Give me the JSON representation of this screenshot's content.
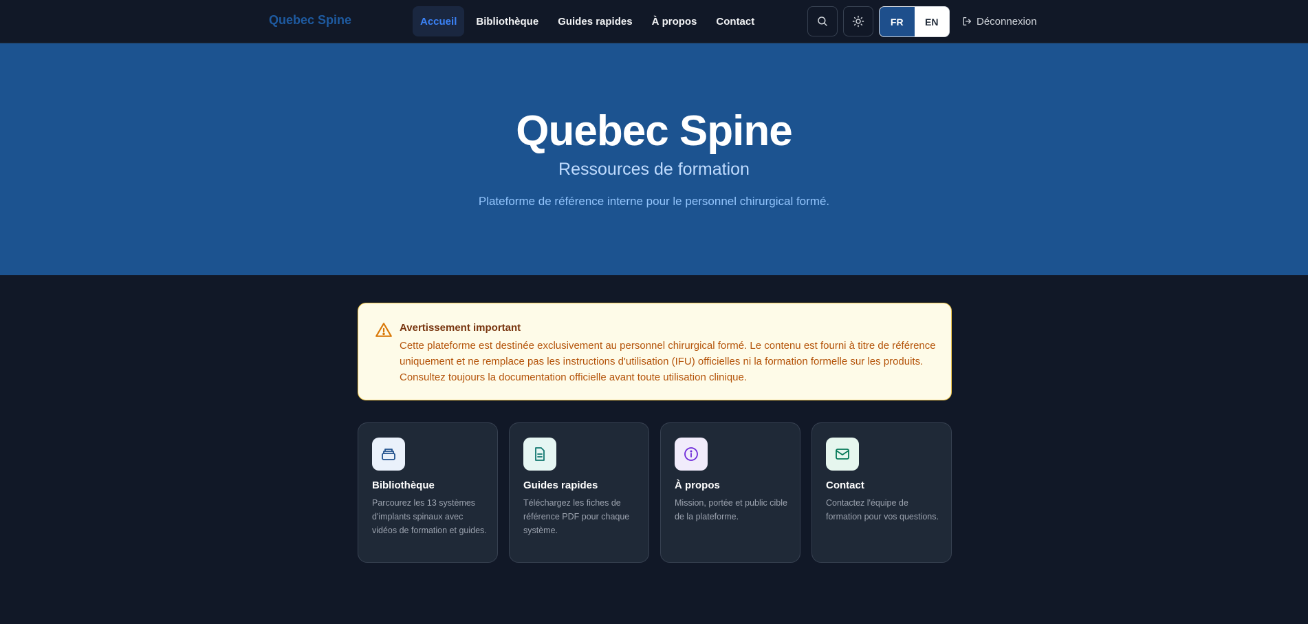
{
  "nav": {
    "brand": "Quebec Spine",
    "links": [
      {
        "label": "Accueil",
        "active": true
      },
      {
        "label": "Bibliothèque",
        "active": false
      },
      {
        "label": "Guides rapides",
        "active": false
      },
      {
        "label": "À propos",
        "active": false
      },
      {
        "label": "Contact",
        "active": false
      }
    ],
    "search_icon": "search-icon",
    "theme_icon": "sun-icon",
    "languages": [
      {
        "label": "FR",
        "active": true
      },
      {
        "label": "EN",
        "active": false
      }
    ],
    "logout_label": "Déconnexion",
    "logout_icon": "logout-icon"
  },
  "hero": {
    "title": "Quebec Spine",
    "subtitle": "Ressources de formation",
    "description": "Plateforme de référence interne pour le personnel chirurgical formé."
  },
  "warning": {
    "icon": "warning-triangle-icon",
    "title": "Avertissement important",
    "text": "Cette plateforme est destinée exclusivement au personnel chirurgical formé. Le contenu est fourni à titre de référence uniquement et ne remplace pas les instructions d'utilisation (IFU) officielles ni la formation formelle sur les produits. Consultez toujours la documentation officielle avant toute utilisation clinique."
  },
  "cards": [
    {
      "title": "Bibliothèque",
      "description": "Parcourez les 13 systèmes d'implants spinaux avec vidéos de formation et guides.",
      "icon": "archive-box-icon",
      "color": "#1e4f8c",
      "bg": "#eaf1fb"
    },
    {
      "title": "Guides rapides",
      "description": "Téléchargez les fiches de référence PDF pour chaque système.",
      "icon": "document-icon",
      "color": "#0f766e",
      "bg": "#e6f6f3"
    },
    {
      "title": "À propos",
      "description": "Mission, portée et public cible de la plateforme.",
      "icon": "info-icon",
      "color": "#6d28d9",
      "bg": "#f1ecfb"
    },
    {
      "title": "Contact",
      "description": "Contactez l'équipe de formation pour vos questions.",
      "icon": "mail-icon",
      "color": "#047857",
      "bg": "#e6f6ee"
    }
  ],
  "colors": {
    "background": "#111827",
    "hero": "#1c5390",
    "accent": "#3b82f6",
    "warning_bg": "#fefbe8",
    "warning_border": "#f3c94d"
  }
}
